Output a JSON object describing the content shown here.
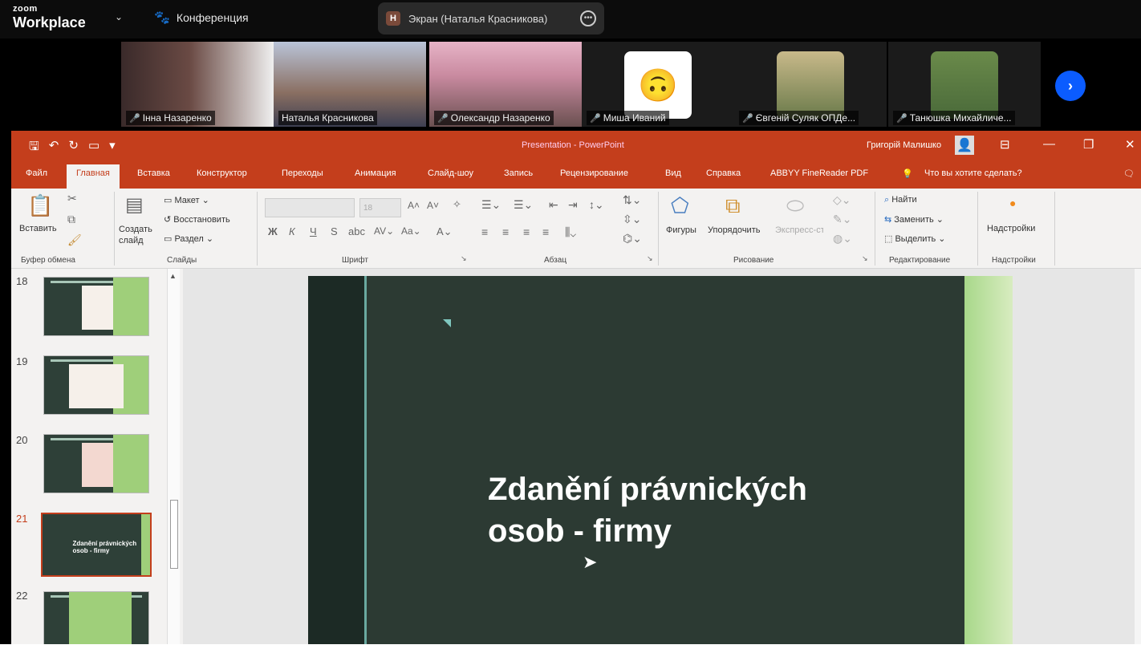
{
  "zoom": {
    "logo_small": "zoom",
    "logo_big": "Workplace",
    "meeting": "Конференция",
    "share_badge": "Н",
    "share_label": "Экран (Наталья Красникова)"
  },
  "participants": [
    {
      "name": "Інна Назаренко"
    },
    {
      "name": "Наталья Красникова"
    },
    {
      "name": "Олександр Назаренко"
    },
    {
      "name": "Миша Иваний"
    },
    {
      "name": "Євгеній Суляк ОПДе..."
    },
    {
      "name": "Танюшка Михайличе..."
    }
  ],
  "powerpoint": {
    "doc_title": "Presentation - PowerPoint",
    "user": "Григорій Малишко",
    "tabs": [
      "Файл",
      "Главная",
      "Вставка",
      "Конструктор",
      "Переходы",
      "Анимация",
      "Слайд-шоу",
      "Запись",
      "Рецензирование",
      "Вид",
      "Справка",
      "ABBYY FineReader PDF",
      "Что вы хотите сделать?"
    ],
    "ribbon": {
      "paste": "Вставить",
      "new_slide": "Создать слайд",
      "layout": "Макет",
      "reset": "Восстановить",
      "section": "Раздел",
      "font_size": "18",
      "shapes": "Фигуры",
      "arrange": "Упорядочить",
      "quick_styles": "Экспресс-стили",
      "find": "Найти",
      "replace": "Заменить",
      "select": "Выделить",
      "addins": "Надстройки",
      "groups": {
        "clipboard": "Буфер обмена",
        "slides": "Слайды",
        "font": "Шрифт",
        "paragraph": "Абзац",
        "drawing": "Рисование",
        "editing": "Редактирование",
        "addins": "Надстройки"
      }
    },
    "thumbnails": [
      {
        "num": "18"
      },
      {
        "num": "19"
      },
      {
        "num": "20"
      },
      {
        "num": "21",
        "mini_title": "Zdanění právnických osob - firmy"
      },
      {
        "num": "22"
      }
    ],
    "slide": {
      "title": "Zdanění právnických\nosob - firmy"
    }
  }
}
